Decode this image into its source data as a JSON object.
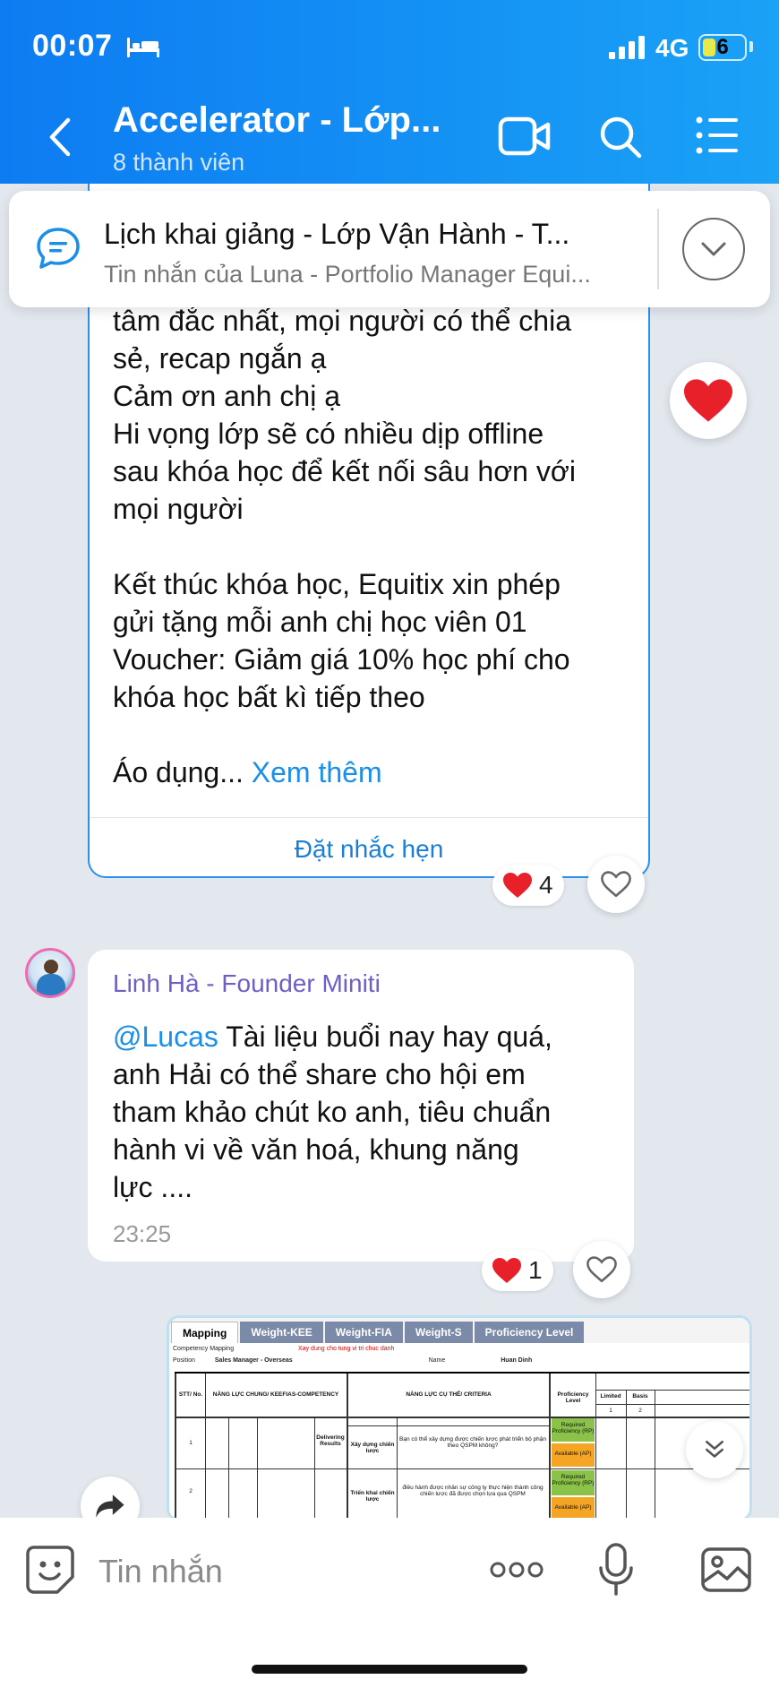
{
  "status_bar": {
    "time": "00:07",
    "network": "4G",
    "battery": "6",
    "battery_level": 0.3
  },
  "header": {
    "title": "Accelerator - Lớp...",
    "subtitle": "8 thành viên",
    "icons": [
      "back-arrow-icon",
      "video-call-icon",
      "search-icon",
      "list-icon"
    ]
  },
  "pinned": {
    "title": "Lịch khai giảng - Lớp Vận Hành - T...",
    "subtitle": "Tin nhắn của Luna - Portfolio Manager Equi..."
  },
  "message1": {
    "lines": [
      "tâm đắc nhất, mọi người có thể chia",
      "sẻ, recap ngắn ạ",
      "Cảm ơn anh chị ạ",
      "Hi vọng lớp sẽ có nhiều dịp offline",
      "sau khóa học để kết nối sâu hơn với",
      "mọi người"
    ],
    "lines2": [
      "Kết thúc khóa học, Equitix xin phép",
      "gửi tặng mỗi anh chị học viên 01",
      "Voucher: Giảm giá 10% học phí cho",
      "khóa học bất kì tiếp theo"
    ],
    "truncated": "Áo dụng... ",
    "see_more": "Xem thêm",
    "action": "Đặt nhắc hẹn",
    "reaction_count": "4"
  },
  "message2": {
    "sender": "Linh Hà - Founder Miniti",
    "mention": "@Lucas",
    "text_first": " Tài liệu buổi nay hay quá,",
    "lines": [
      "anh Hải có thể share cho hội em",
      "tham khảo chút ko anh, tiêu chuẩn",
      "hành vi về văn hoá, khung năng",
      "lực ...."
    ],
    "time": "23:25",
    "reaction_count": "1"
  },
  "sheet": {
    "tabs": [
      "Mapping",
      "Weight-KEE",
      "Weight-FIA",
      "Weight-S",
      "Proficiency Level"
    ],
    "row1_label": "Competency Mapping",
    "row1_red": "Xay dung cho tung vi tri chuc danh",
    "row2_label": "Position",
    "row2_value": "Sales Manager - Overseas",
    "row2_name_label": "Name",
    "row2_name_value": "Huan Dinh",
    "col_stt": "STT/ No.",
    "col_general": "NĂNG LỰC CHUNG/ KEEFIAS-COMPETENCY",
    "col_specific": "NĂNG LỰC CỤ THỂ/ CRITERIA",
    "col_prof": "Proficiency Level",
    "col_limited": "Limited",
    "col_basis": "Basis",
    "row_a_no": "1",
    "row_a_group": "Delivering Results",
    "row_a_item": "Xây dựng chiến lược",
    "row_a_q": "Bạn có thể xây dựng được chiến lược phát triển bộ phận theo QSPM không?",
    "row_b_no": "2",
    "row_b_item": "Triển khai chiến lược",
    "row_b_q": "điều hành được nhân sự công ty thực hiện thành công chiến lược đã được chọn lựa qua QSPM",
    "req": "Required Proficiency (RP)",
    "avail": "Available (AP)",
    "num1": "1",
    "num2": "2"
  },
  "input": {
    "placeholder": "Tin nhắn"
  },
  "colors": {
    "header_start": "#0d7cf2",
    "header_end": "#1aa2f6",
    "link": "#1a8fe8",
    "sender": "#6c5fc6",
    "heart": "#e8202a",
    "background": "#e3e8ef"
  }
}
